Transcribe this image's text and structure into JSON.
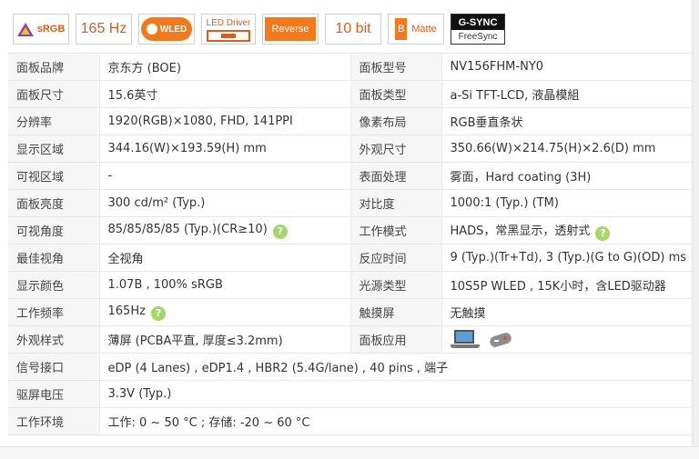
{
  "badges": {
    "srgb": "sRGB",
    "refresh": "165 Hz",
    "wled": "WLED",
    "driver": "LED Driver",
    "reverse": "Reverse",
    "bit": "10 bit",
    "matte_letter": "B",
    "matte": "Matte",
    "gsync_top": "G-SYNC",
    "gsync_bottom": "FreeSync"
  },
  "specs": [
    {
      "label1": "面板品牌",
      "value1": "京东方 (BOE)",
      "label2": "面板型号",
      "value2": "NV156FHM-NY0"
    },
    {
      "label1": "面板尺寸",
      "value1": "15.6英寸",
      "label2": "面板类型",
      "value2": "a-Si TFT-LCD, 液晶模組"
    },
    {
      "label1": "分辨率",
      "value1": "1920(RGB)×1080, FHD, 141PPI",
      "label2": "像素布局",
      "value2": "RGB垂直条状"
    },
    {
      "label1": "显示区域",
      "value1": "344.16(W)×193.59(H) mm",
      "label2": "外观尺寸",
      "value2": "350.66(W)×214.75(H)×2.6(D) mm"
    },
    {
      "label1": "可视区域",
      "value1": "-",
      "label2": "表面处理",
      "value2": "雾面，Hard coating (3H)"
    },
    {
      "label1": "面板亮度",
      "value1": "300 cd/m² (Typ.)",
      "label2": "对比度",
      "value2": "1000:1 (Typ.) (TM)"
    },
    {
      "label1": "可视角度",
      "value1": "85/85/85/85 (Typ.)(CR≥10)",
      "label2": "工作模式",
      "value2": "HADS，常黑显示，透射式"
    },
    {
      "label1": "最佳视角",
      "value1": "全视角",
      "label2": "反应时间",
      "value2": "9 (Typ.)(Tr+Td), 3 (Typ.)(G to G)(OD) ms"
    },
    {
      "label1": "显示颜色",
      "value1": "1.07B , 100% sRGB",
      "label2": "光源类型",
      "value2": "10S5P WLED , 15K小时，含LED驱动器"
    },
    {
      "label1": "工作频率",
      "value1": "165Hz",
      "label2": "触摸屏",
      "value2": "无触摸"
    },
    {
      "label1": "外观样式",
      "value1": "薄屏 (PCBA平直, 厚度≤3.2mm)",
      "label2": "面板应用",
      "value2": ""
    },
    {
      "label1": "信号接口",
      "value1": "eDP (4 Lanes) , eDP1.4 , HBR2 (5.4G/lane) , 40 pins , 端子"
    },
    {
      "label1": "驱屏电压",
      "value1": "3.3V (Typ.)"
    },
    {
      "label1": "工作环境",
      "value1": "工作: 0 ~ 50 °C ; 存储: -20 ~ 60 °C"
    }
  ],
  "help_glyph": "?",
  "colors": {
    "accent": "#f07a1c",
    "badge_text": "#e05a1a",
    "help": "#a5d66c",
    "label_bg": "#f6f6f6"
  }
}
